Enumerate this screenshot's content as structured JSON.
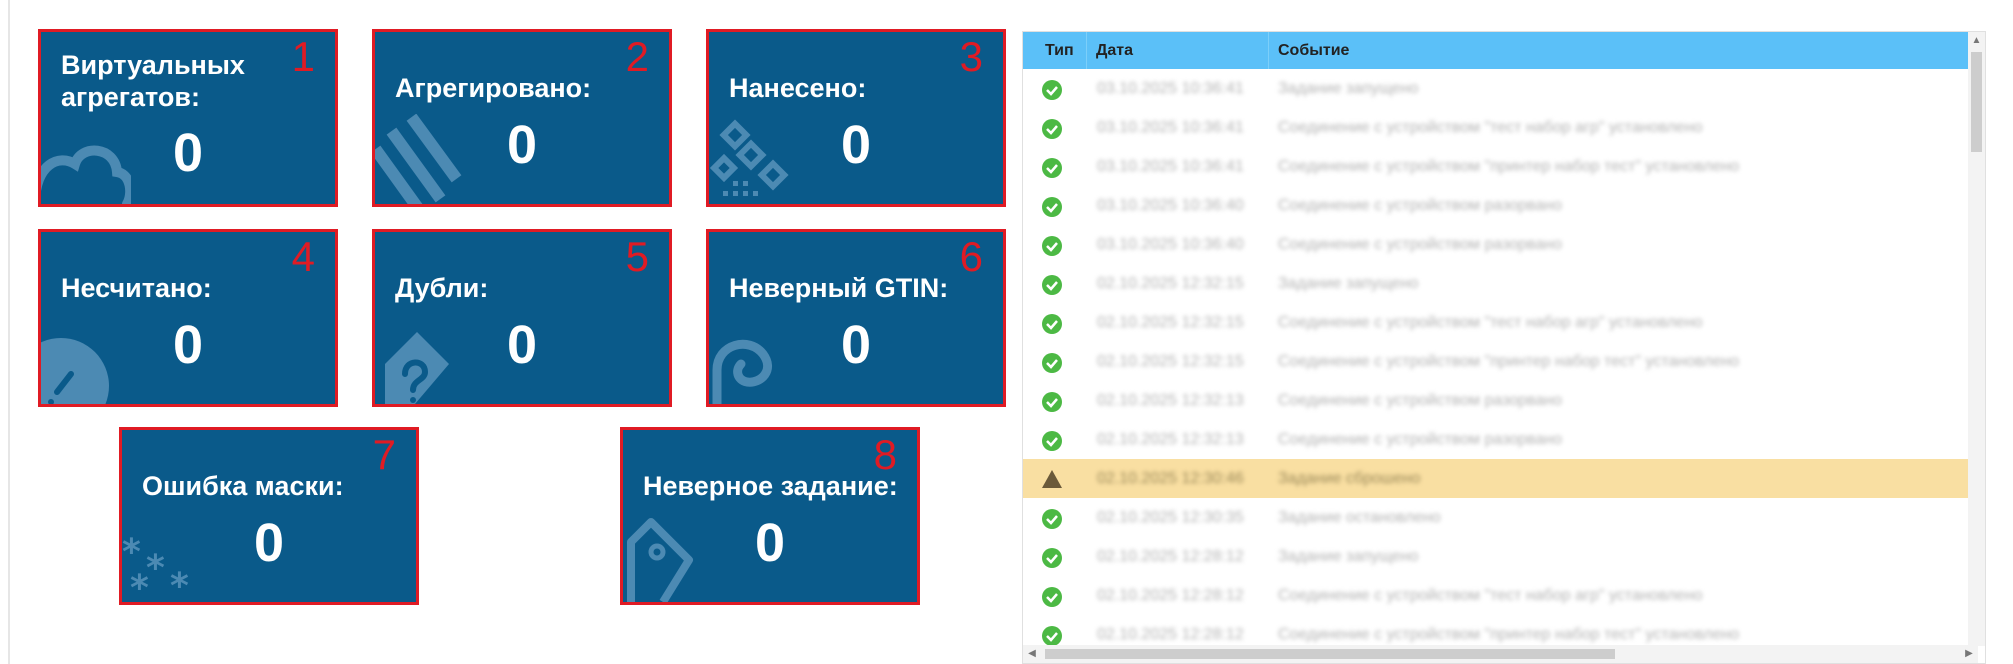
{
  "tiles": [
    {
      "badge": "1",
      "label": "Виртуальных агрегатов:",
      "value": "0",
      "icon": "cloud-icon"
    },
    {
      "badge": "2",
      "label": "Агрегировано:",
      "value": "0",
      "icon": "stripes-icon"
    },
    {
      "badge": "3",
      "label": "Нанесено:",
      "value": "0",
      "icon": "datamatrix-icon"
    },
    {
      "badge": "4",
      "label": "Несчитано:",
      "value": "0",
      "icon": "unread-icon"
    },
    {
      "badge": "5",
      "label": "Дубли:",
      "value": "0",
      "icon": "duplicate-icon"
    },
    {
      "badge": "6",
      "label": "Неверный GTIN:",
      "value": "0",
      "icon": "wrong-code-icon"
    },
    {
      "badge": "7",
      "label": "Ошибка маски:",
      "value": "0",
      "icon": "mask-asterisks-icon"
    },
    {
      "badge": "8",
      "label": "Неверное задание:",
      "value": "0",
      "icon": "tag-icon"
    }
  ],
  "log": {
    "headers": {
      "type": "Тип",
      "date": "Дата",
      "event": "Событие"
    },
    "rows": [
      {
        "status": "ok",
        "date": "03.10.2025 10:36:41",
        "event": "Задание запущено"
      },
      {
        "status": "ok",
        "date": "03.10.2025 10:36:41",
        "event": "Соединение с устройством \"тест набор агр\" установлено"
      },
      {
        "status": "ok",
        "date": "03.10.2025 10:36:41",
        "event": "Соединение с устройством \"принтер набор тест\" установлено"
      },
      {
        "status": "ok",
        "date": "03.10.2025 10:36:40",
        "event": "Соединение с устройством разорвано"
      },
      {
        "status": "ok",
        "date": "03.10.2025 10:36:40",
        "event": "Соединение с устройством разорвано"
      },
      {
        "status": "ok",
        "date": "02.10.2025 12:32:15",
        "event": "Задание запущено"
      },
      {
        "status": "ok",
        "date": "02.10.2025 12:32:15",
        "event": "Соединение с устройством \"тест набор агр\" установлено"
      },
      {
        "status": "ok",
        "date": "02.10.2025 12:32:15",
        "event": "Соединение с устройством \"принтер набор тест\" установлено"
      },
      {
        "status": "ok",
        "date": "02.10.2025 12:32:13",
        "event": "Соединение с устройством разорвано"
      },
      {
        "status": "ok",
        "date": "02.10.2025 12:32:13",
        "event": "Соединение с устройством разорвано"
      },
      {
        "status": "warn",
        "date": "02.10.2025 12:30:46",
        "event": "Задание сброшено"
      },
      {
        "status": "ok",
        "date": "02.10.2025 12:30:35",
        "event": "Задание остановлено"
      },
      {
        "status": "ok",
        "date": "02.10.2025 12:28:12",
        "event": "Задание запущено"
      },
      {
        "status": "ok",
        "date": "02.10.2025 12:28:12",
        "event": "Соединение с устройством \"тест набор агр\" установлено"
      },
      {
        "status": "ok",
        "date": "02.10.2025 12:28:12",
        "event": "Соединение с устройством \"принтер набор тест\" установлено"
      }
    ]
  },
  "colors": {
    "tile_bg": "#0a5a8a",
    "tile_border": "#e01b24",
    "badge": "#e01b24",
    "header_bg": "#5bc0f8",
    "ok": "#4cb944",
    "warn_row": "#f9dfa2",
    "warn_icon": "#6b5a3a"
  }
}
